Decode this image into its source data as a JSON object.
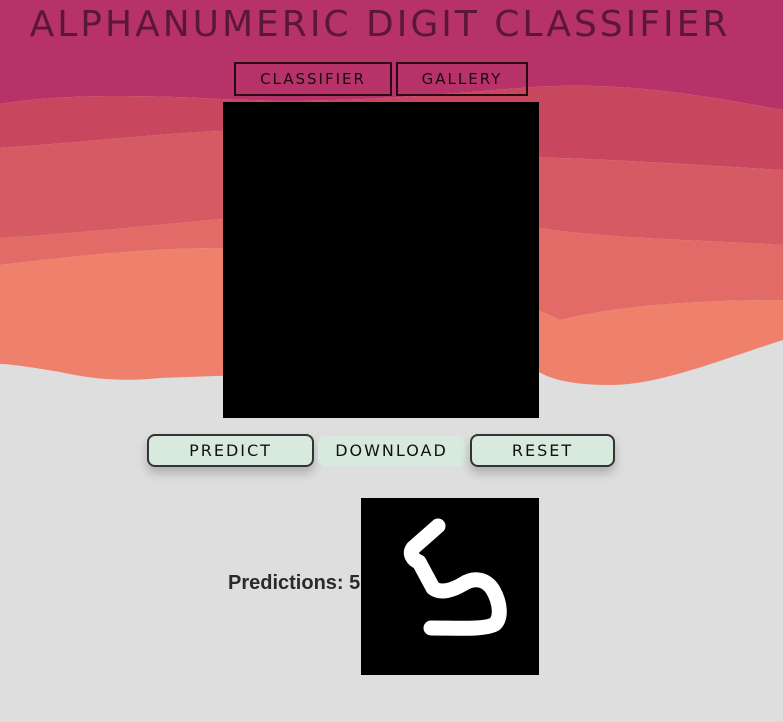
{
  "header": {
    "title": "ALPHANUMERIC DIGIT CLASSIFIER"
  },
  "nav": {
    "classifier_label": "CLASSIFIER",
    "gallery_label": "GALLERY"
  },
  "actions": {
    "predict_label": "PREDICT",
    "download_label": "DOWNLOAD",
    "reset_label": "RESET"
  },
  "result": {
    "prediction_text": "Predictions: 5"
  },
  "colors": {
    "wave_top": "#b8326a",
    "wave_mid": "#d65a63",
    "wave_bottom": "#ee806c",
    "background": "#dedede",
    "button_fill": "#d7eadd"
  }
}
